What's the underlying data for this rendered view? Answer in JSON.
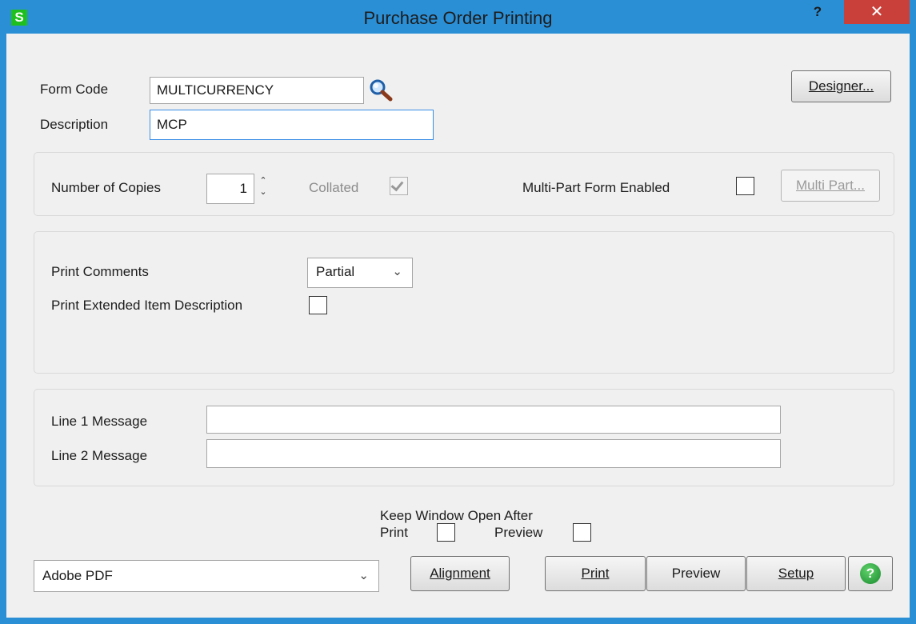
{
  "window": {
    "title": "Purchase Order Printing",
    "logo": "S",
    "help_glyph": "?",
    "close_glyph": "✕"
  },
  "header": {
    "form_code_label": "Form Code",
    "form_code_value": "MULTICURRENCY",
    "description_label": "Description",
    "description_value": "MCP",
    "designer_label": "Designer..."
  },
  "copies": {
    "label": "Number of Copies",
    "value": "1",
    "collated_label": "Collated",
    "collated_checked": true,
    "multipart_label": "Multi-Part Form Enabled",
    "multipart_checked": false,
    "multipart_button": "Multi Part..."
  },
  "options": {
    "print_comments_label": "Print Comments",
    "print_comments_value": "Partial",
    "extended_desc_label": "Print Extended Item Description",
    "extended_desc_checked": false
  },
  "messages": {
    "line1_label": "Line 1 Message",
    "line1_value": "",
    "line2_label": "Line 2 Message",
    "line2_value": ""
  },
  "keep_open": {
    "label": "Keep Window Open After",
    "print_label": "Print",
    "preview_label": "Preview",
    "print_checked": false,
    "preview_checked": false
  },
  "footer": {
    "printer_value": "Adobe PDF",
    "alignment_label": "Alignment",
    "print_label": "Print",
    "preview_label": "Preview",
    "setup_label": "Setup",
    "help_glyph": "?"
  }
}
